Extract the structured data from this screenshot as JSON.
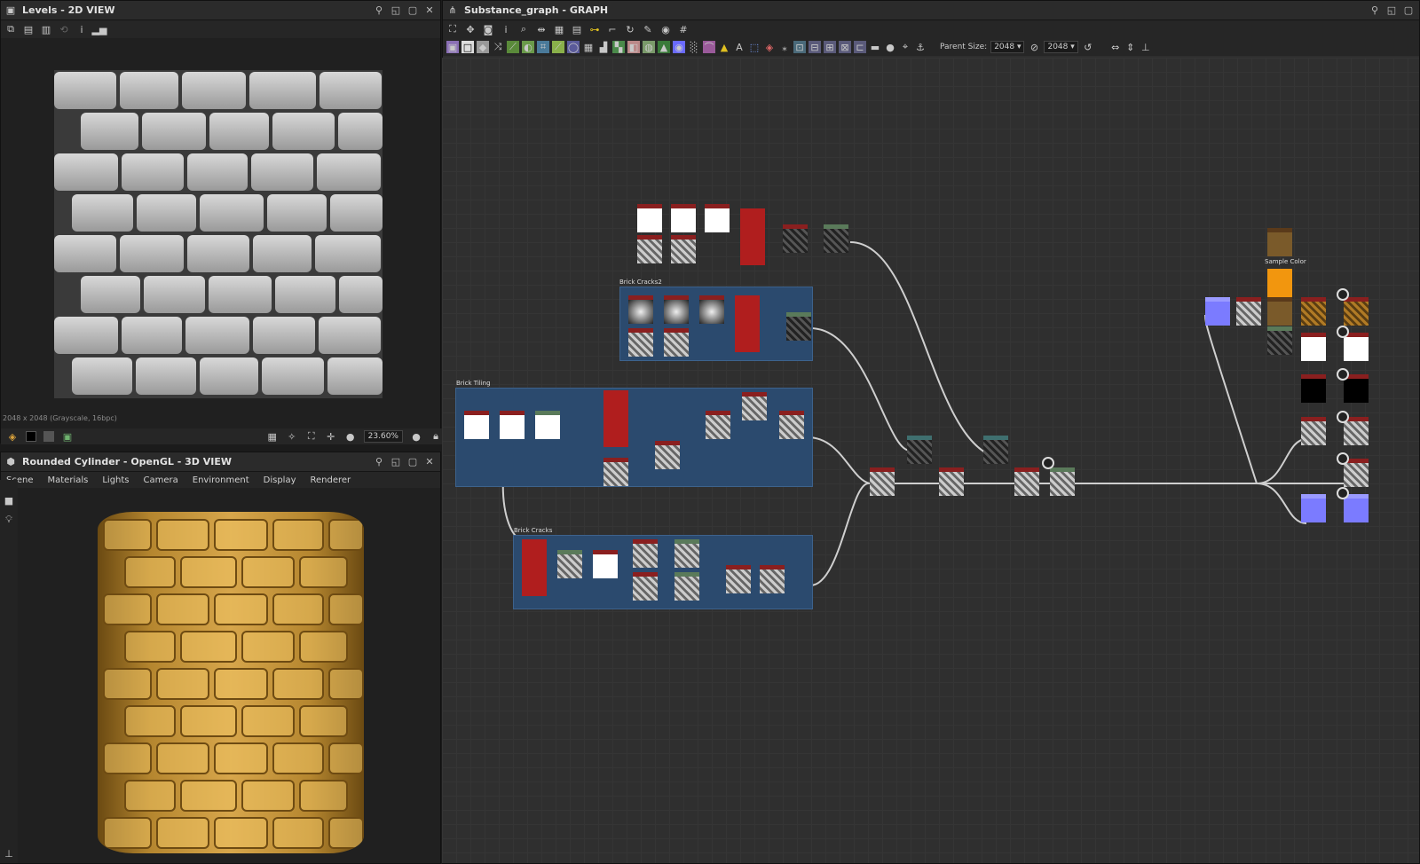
{
  "levels_panel": {
    "title": "Levels - 2D VIEW",
    "texture_info": "2048 x 2048 (Grayscale, 16bpc)",
    "zoom": "23.60%"
  },
  "view3d_panel": {
    "title": "Rounded Cylinder - OpenGL - 3D VIEW",
    "menu": [
      "Scene",
      "Materials",
      "Lights",
      "Camera",
      "Environment",
      "Display",
      "Renderer"
    ]
  },
  "graph_panel": {
    "title": "Substance_graph - GRAPH",
    "parent_size_label": "Parent Size:",
    "parent_size_value": "2048",
    "output_size_value": "2048",
    "frames": {
      "brick_cracks2": "Brick Cracks2",
      "brick_tiling": "Brick Tiling",
      "brick_cracks": "Brick Cracks",
      "sample_color": "Sample Color"
    }
  }
}
